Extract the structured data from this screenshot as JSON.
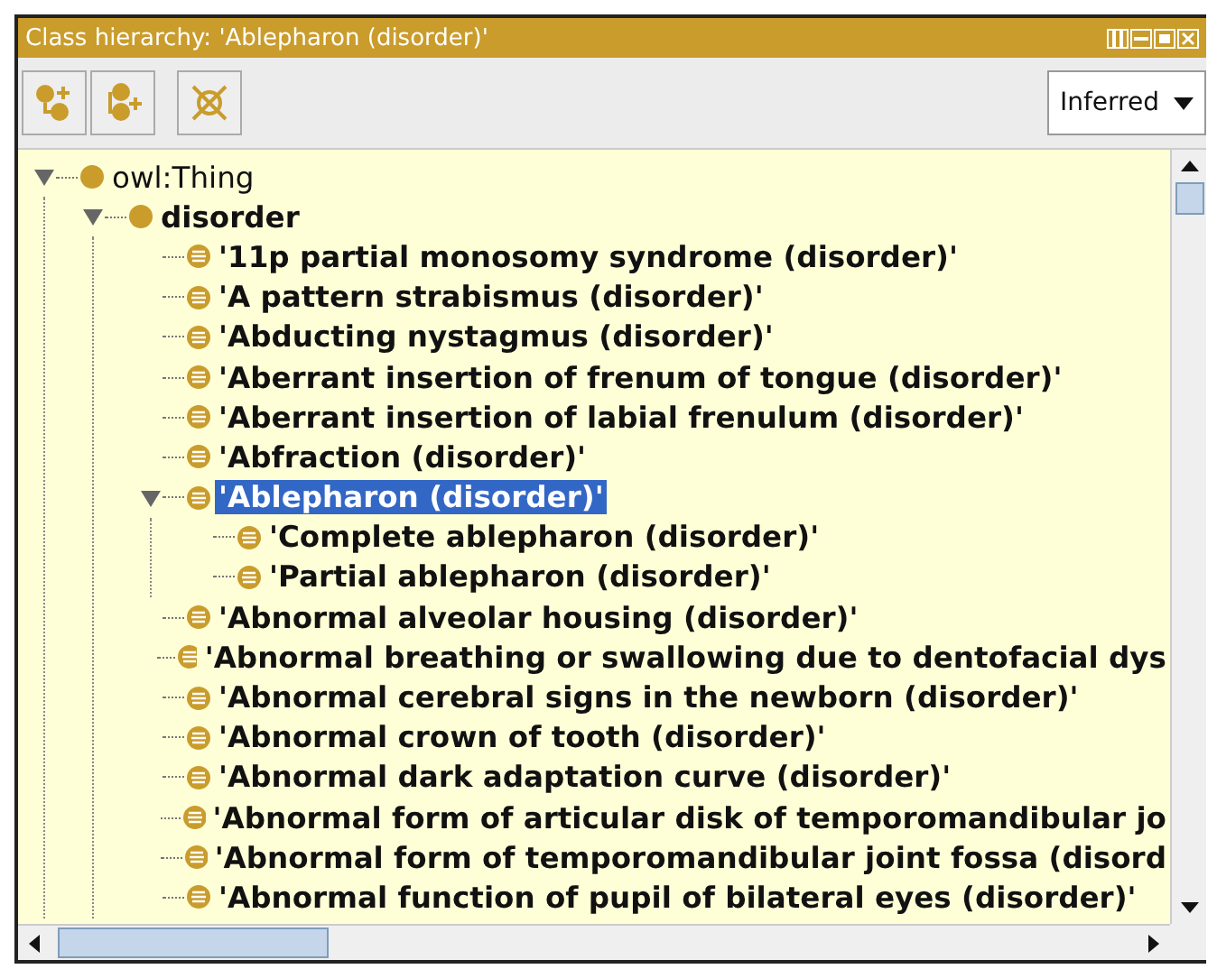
{
  "window": {
    "title": "Class hierarchy: 'Ablepharon (disorder)'"
  },
  "toolbar": {
    "view_select": {
      "value": "Inferred"
    }
  },
  "tree": [
    {
      "label": "owl:Thing",
      "kind": "plain",
      "bold": false,
      "selected": false,
      "expanded": true,
      "children": [
        {
          "label": "disorder",
          "kind": "plain",
          "bold": true,
          "selected": false,
          "expanded": true,
          "children": [
            {
              "label": "'11p partial monosomy syndrome (disorder)'",
              "kind": "defined",
              "bold": true,
              "selected": false
            },
            {
              "label": "'A pattern strabismus (disorder)'",
              "kind": "defined",
              "bold": true,
              "selected": false
            },
            {
              "label": "'Abducting nystagmus (disorder)'",
              "kind": "defined",
              "bold": true,
              "selected": false
            },
            {
              "label": "'Aberrant insertion of frenum of tongue (disorder)'",
              "kind": "defined",
              "bold": true,
              "selected": false
            },
            {
              "label": "'Aberrant insertion of labial frenulum (disorder)'",
              "kind": "defined",
              "bold": true,
              "selected": false
            },
            {
              "label": "'Abfraction (disorder)'",
              "kind": "defined",
              "bold": true,
              "selected": false
            },
            {
              "label": "'Ablepharon (disorder)'",
              "kind": "defined",
              "bold": true,
              "selected": true,
              "expanded": true,
              "children": [
                {
                  "label": "'Complete ablepharon (disorder)'",
                  "kind": "defined",
                  "bold": true,
                  "selected": false
                },
                {
                  "label": "'Partial ablepharon (disorder)'",
                  "kind": "defined",
                  "bold": true,
                  "selected": false
                }
              ]
            },
            {
              "label": "'Abnormal alveolar housing (disorder)'",
              "kind": "defined",
              "bold": true,
              "selected": false
            },
            {
              "label": "'Abnormal breathing or swallowing due to dentofacial dys",
              "kind": "defined",
              "bold": true,
              "selected": false
            },
            {
              "label": "'Abnormal cerebral signs in the newborn (disorder)'",
              "kind": "defined",
              "bold": true,
              "selected": false
            },
            {
              "label": "'Abnormal crown of tooth (disorder)'",
              "kind": "defined",
              "bold": true,
              "selected": false
            },
            {
              "label": "'Abnormal dark adaptation curve (disorder)'",
              "kind": "defined",
              "bold": true,
              "selected": false
            },
            {
              "label": "'Abnormal form of articular disk of temporomandibular jo",
              "kind": "defined",
              "bold": true,
              "selected": false
            },
            {
              "label": "'Abnormal form of temporomandibular joint fossa (disord",
              "kind": "defined",
              "bold": true,
              "selected": false
            },
            {
              "label": "'Abnormal function of pupil of bilateral eyes (disorder)'",
              "kind": "defined",
              "bold": true,
              "selected": false
            }
          ]
        }
      ]
    }
  ]
}
